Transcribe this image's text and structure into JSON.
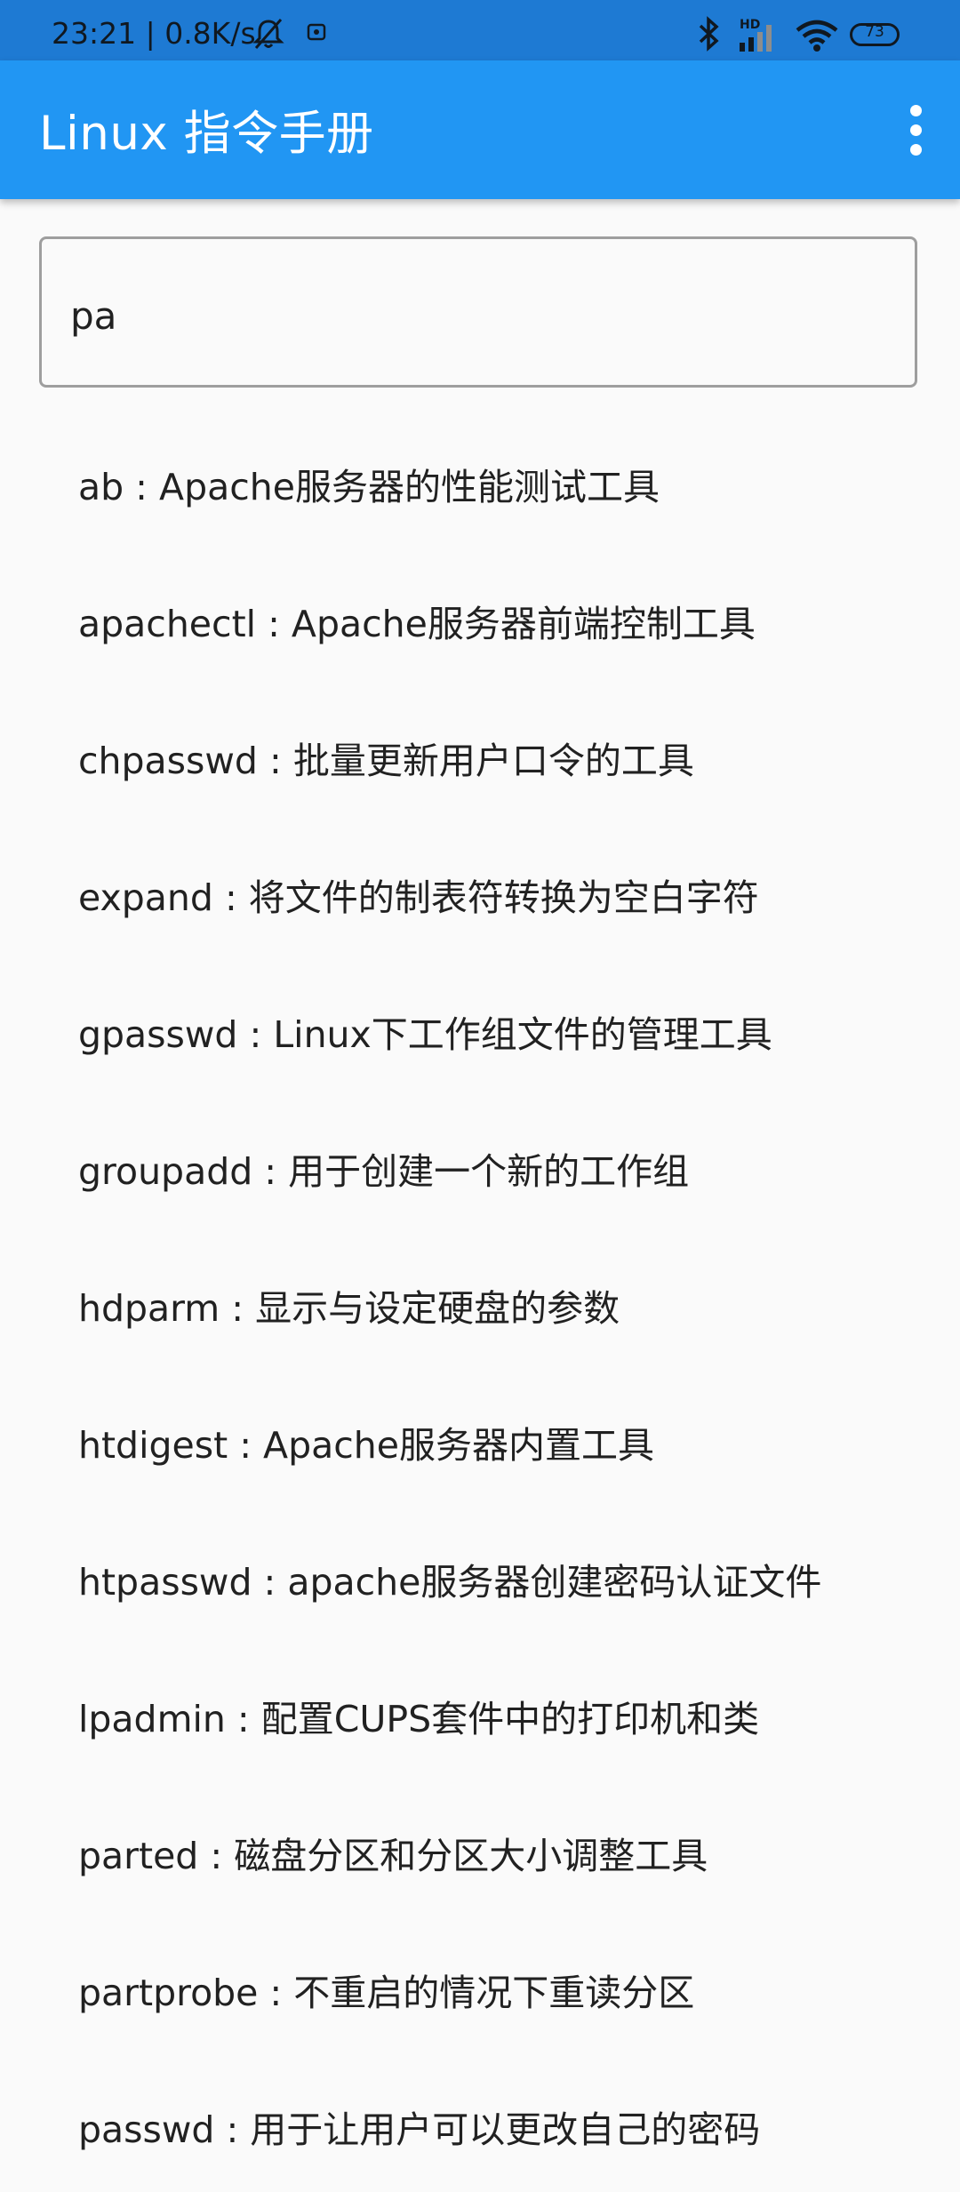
{
  "status_bar": {
    "time_speed": "23:21 | 0.8K/s",
    "network_label": "HD",
    "battery": "73"
  },
  "app_bar": {
    "title": "Linux 指令手册"
  },
  "search": {
    "value": "pa"
  },
  "results": [
    "ab : Apache服务器的性能测试工具",
    "apachectl : Apache服务器前端控制工具",
    "chpasswd : 批量更新用户口令的工具",
    "expand : 将文件的制表符转换为空白字符",
    "gpasswd : Linux下工作组文件的管理工具",
    "groupadd : 用于创建一个新的工作组",
    "hdparm : 显示与设定硬盘的参数",
    "htdigest : Apache服务器内置工具",
    "htpasswd : apache服务器创建密码认证文件",
    "lpadmin : 配置CUPS套件中的打印机和类",
    "parted : 磁盘分区和分区大小调整工具",
    "partprobe : 不重启的情况下重读分区",
    "passwd : 用于让用户可以更改自己的密码"
  ],
  "colors": {
    "status_bar": "#1e7ad3",
    "app_bar": "#2196f3",
    "background": "#fafafa",
    "text": "#212121"
  }
}
